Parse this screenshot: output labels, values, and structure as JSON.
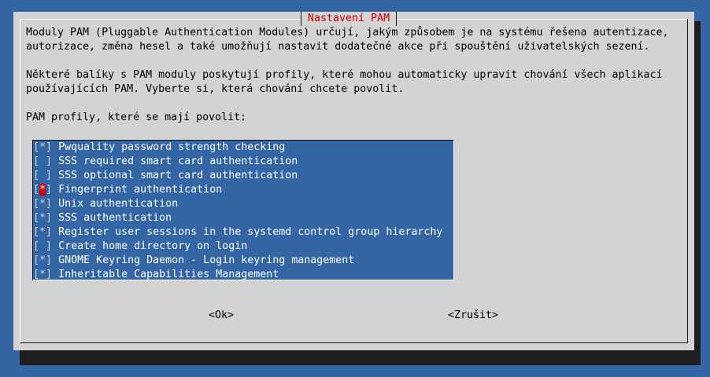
{
  "dialog": {
    "title": "Nastavení PAM",
    "intro_line1": "Moduly PAM (Pluggable Authentication Modules) určují, jakým způsobem je na systému řešena autentizace,",
    "intro_line2": "autorizace, změna hesel a také umožňují nastavit dodatečné akce při spouštění uživatelských sezení.",
    "intro_line3": "Některé balíky s PAM moduly poskytují profily, které mohou automaticky upravit chování všech aplikací",
    "intro_line4": "používajících PAM. Vyberte si, která chování chcete povolit.",
    "prompt": "PAM profily, které se mají povolit:"
  },
  "profiles": [
    {
      "open": "[",
      "mark": "*",
      "close": "]",
      "label": "Pwquality password strength checking"
    },
    {
      "open": "[",
      "mark": " ",
      "close": "]",
      "label": "SSS required smart card authentication"
    },
    {
      "open": "[",
      "mark": " ",
      "close": "]",
      "label": "SSS optional smart card authentication"
    },
    {
      "open": "[",
      "mark": "*",
      "close": "]",
      "label": "Fingerprint authentication"
    },
    {
      "open": "[",
      "mark": "*",
      "close": "]",
      "label": "Unix authentication"
    },
    {
      "open": "[",
      "mark": "*",
      "close": "]",
      "label": "SSS authentication"
    },
    {
      "open": "[",
      "mark": "*",
      "close": "]",
      "label": "Register user sessions in the systemd control group hierarchy"
    },
    {
      "open": "[",
      "mark": " ",
      "close": "]",
      "label": "Create home directory on login"
    },
    {
      "open": "[",
      "mark": "*",
      "close": "]",
      "label": "GNOME Keyring Daemon - Login keyring management"
    },
    {
      "open": "[",
      "mark": "*",
      "close": "]",
      "label": "Inheritable Capabilities Management"
    }
  ],
  "buttons": {
    "ok": "<Ok>",
    "cancel": "<Zrušit>"
  },
  "colors": {
    "background": "#3465a4",
    "dialog": "#d3d3d3",
    "title": "#cc0000",
    "cursor": "#cc0000"
  }
}
